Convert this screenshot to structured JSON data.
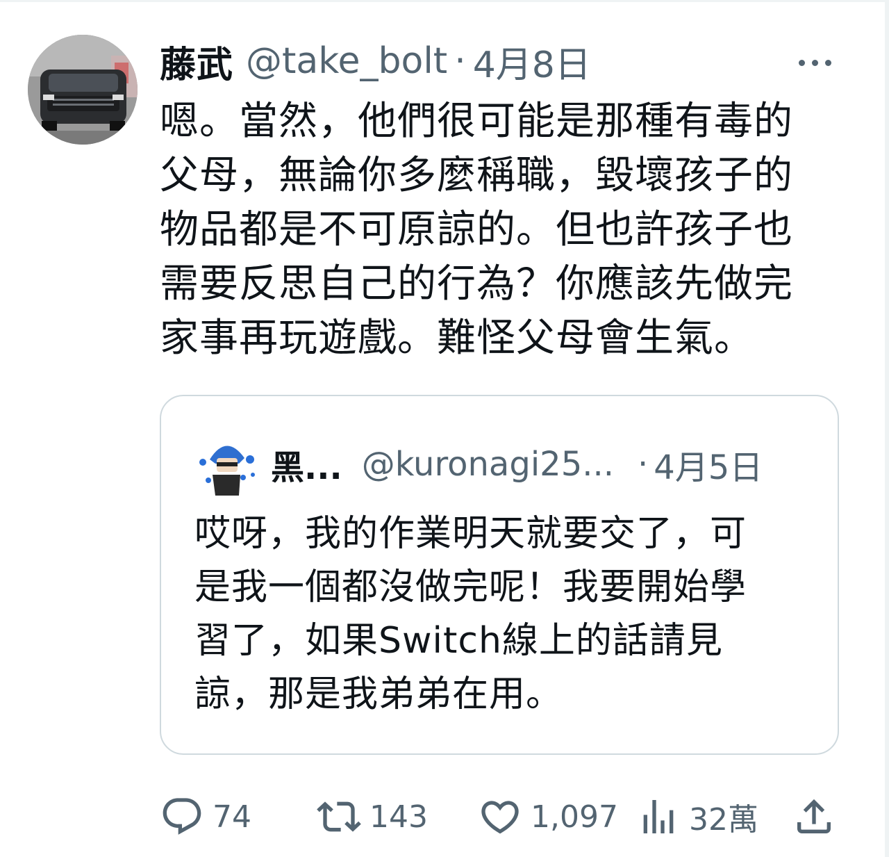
{
  "tweet": {
    "display_name": "藤武",
    "handle": "@take_bolt",
    "separator": "·",
    "date": "4月8日",
    "more_icon": "more-horizontal-icon",
    "text": "嗯。當然，他們很可能是那種有毒的\n父母，無論你多麼稱職，毀壞孩子的\n物品都是不可原諒的。但也許孩子也\n需要反思自己的行為？你應該先做完\n家事再玩遊戲。難怪父母會生氣。"
  },
  "quote": {
    "display_name": "黑...",
    "handle": "@kuronagi25...",
    "separator": "·",
    "date": "4月5日",
    "text": "哎呀，我的作業明天就要交了，可\n是我一個都沒做完呢！我要開始學\n習了，如果Switch線上的話請見\n諒，那是我弟弟在用。"
  },
  "actions": {
    "reply": {
      "icon": "reply-icon",
      "count": "74"
    },
    "retweet": {
      "icon": "retweet-icon",
      "count": "143"
    },
    "like": {
      "icon": "heart-icon",
      "count": "1,097"
    },
    "views": {
      "icon": "views-chart-icon",
      "count": "32萬"
    },
    "share": {
      "icon": "share-icon"
    }
  },
  "colors": {
    "text_primary": "#0f1419",
    "text_secondary": "#536471",
    "border": "#cfd9de"
  }
}
